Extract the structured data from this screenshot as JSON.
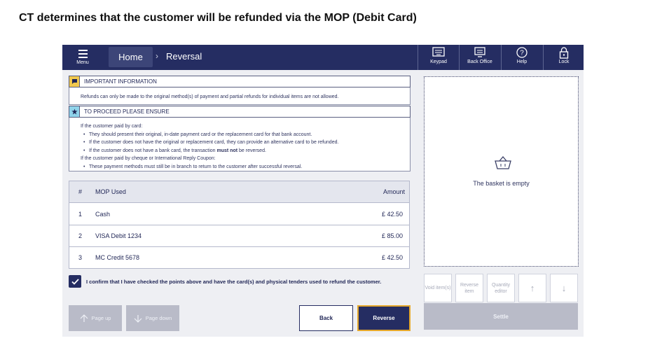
{
  "caption": "CT determines that the customer will be refunded via the MOP (Debit Card)",
  "topbar": {
    "menu_label": "Menu",
    "breadcrumb_home": "Home",
    "breadcrumb_sep": "›",
    "breadcrumb_current": "Reversal",
    "tools": [
      {
        "label": "Keypad",
        "icon": "keypad-icon"
      },
      {
        "label": "Back Office",
        "icon": "back-office-icon"
      },
      {
        "label": "Help",
        "icon": "help-icon"
      },
      {
        "label": "Lock",
        "icon": "lock-icon"
      }
    ]
  },
  "important": {
    "title": "IMPORTANT INFORMATION",
    "text": "Refunds can only be made to the original method(s) of payment and partial refunds for individual items are not allowed."
  },
  "ensure": {
    "title": "TO PROCEED PLEASE ENSURE",
    "card_intro": "If the customer paid by card:",
    "card_bullets": [
      "They should present their original, in-date payment card or the replacement card for that bank account.",
      "If the customer does not have the original or replacement card, they can provide an alternative card to be refunded."
    ],
    "bullet3_pre": "If the customer does not have a bank card, the transaction ",
    "bullet3_bold": "must not",
    "bullet3_post": " be reversed.",
    "cheque_intro": "If the customer paid by cheque or International Reply Coupon:",
    "cheque_bullet": "These payment methods must still be in branch to return to the customer after successful reversal."
  },
  "table": {
    "headers": {
      "num": "#",
      "mop": "MOP Used",
      "amount": "Amount"
    },
    "rows": [
      {
        "num": "1",
        "mop": "Cash",
        "amount": "£ 42.50"
      },
      {
        "num": "2",
        "mop": "VISA Debit 1234",
        "amount": "£ 85.00"
      },
      {
        "num": "3",
        "mop": "MC Credit 5678",
        "amount": "£ 42.50"
      }
    ]
  },
  "confirm_text": "I confirm that I have checked the points above and have the card(s) and physical tenders used to refund the customer.",
  "buttons": {
    "page_up": "Page up",
    "page_down": "Page down",
    "back": "Back",
    "reverse": "Reverse"
  },
  "basket": {
    "empty_text": "The basket is empty"
  },
  "actions": {
    "void": "Void item(s)",
    "reverse_item": "Reverse item",
    "quantity": "Quantity editor",
    "up": "↑",
    "down": "↓",
    "settle": "Settle"
  },
  "colors": {
    "primary": "#252d62",
    "accent": "#e5a82c",
    "disabled": "#b9bbc8"
  }
}
